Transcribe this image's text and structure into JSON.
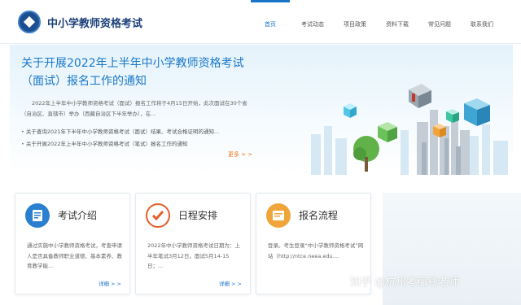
{
  "header": {
    "site_name": "中小学教师资格考试",
    "nav": [
      {
        "label": "首页",
        "active": true
      },
      {
        "label": "考试动态",
        "active": false
      },
      {
        "label": "项目政策",
        "active": false
      },
      {
        "label": "资料下载",
        "active": false
      },
      {
        "label": "常见问题",
        "active": false
      },
      {
        "label": "联系我们",
        "active": false
      }
    ]
  },
  "banner": {
    "title": "关于开展2022年上半年中小学教师资格考试（面试）报名工作的通知",
    "desc": "2022年上半年中小学教师资格考试（面试）报名工作将于4月15日开始，此次面试在30个省（自治区、直辖市）举办（西藏自治区下半年举办），在...",
    "links": [
      "关于查询2021年下半年中小学教师资格考试（面试）结果、考试合格证明的通知...",
      "关于开展2022年上半年中小学教师资格考试（笔试）报名工作的通知"
    ],
    "more": "更多 > >"
  },
  "cards": [
    {
      "title": "考试介绍",
      "text": "通过实施中小学教师资格考试，考查申请人是否具备教师职业道德、基本素养、教育教学能...",
      "more": "详细 > >",
      "color": "#2a7fd0"
    },
    {
      "title": "日程安排",
      "text": "2022年中小学教师资格考试日期为：上半年笔试3月12日，面试5月14-15日；...",
      "more": "详细 > >",
      "color": "#e2602b"
    },
    {
      "title": "报名流程",
      "text": "登录。考生登录“中小学教师资格考试”网站（http://ntce.neea.edu....",
      "more": "",
      "color": "#f0a53a"
    }
  ],
  "watermark": "知乎 @杭州考编钱老师"
}
